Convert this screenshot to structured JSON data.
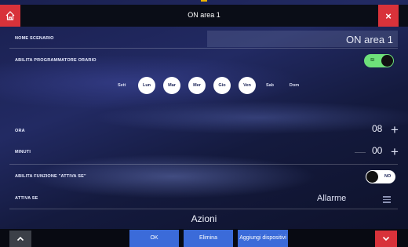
{
  "header": {
    "title": "ON area 1",
    "home_icon": "home-icon",
    "close_label": "×"
  },
  "scenario_name": {
    "label": "NOME SCENARIO",
    "value": "ON area 1"
  },
  "scheduler": {
    "label": "ABILITA PROGRAMMATORE ORARIO",
    "toggle_text": "SI",
    "enabled": true,
    "week_label": "Sett",
    "days": [
      {
        "label": "Lun",
        "selected": true
      },
      {
        "label": "Mar",
        "selected": true
      },
      {
        "label": "Mer",
        "selected": true
      },
      {
        "label": "Gio",
        "selected": true
      },
      {
        "label": "Ven",
        "selected": true
      },
      {
        "label": "Sab",
        "selected": false
      },
      {
        "label": "Dom",
        "selected": false
      }
    ]
  },
  "time": {
    "hour_label": "ORA",
    "hour_value": "08",
    "minutes_label": "MINUTI",
    "minutes_value": "00",
    "plus_symbol": "+"
  },
  "activate_if": {
    "enable_label": "ABILITA FUNZIONE \"ATTIVA SE\"",
    "toggle_text": "NO",
    "enabled": false,
    "label": "ATTIVA SE",
    "value": "Allarme"
  },
  "actions": {
    "title": "Azioni"
  },
  "footer": {
    "ok_label": "OK",
    "delete_label": "Elimina",
    "add_devices_label": "Aggiungi dispositivi"
  },
  "colors": {
    "accent_red": "#d8323a",
    "button_blue": "#3b6bd9",
    "toggle_green": "#6ee07a"
  }
}
